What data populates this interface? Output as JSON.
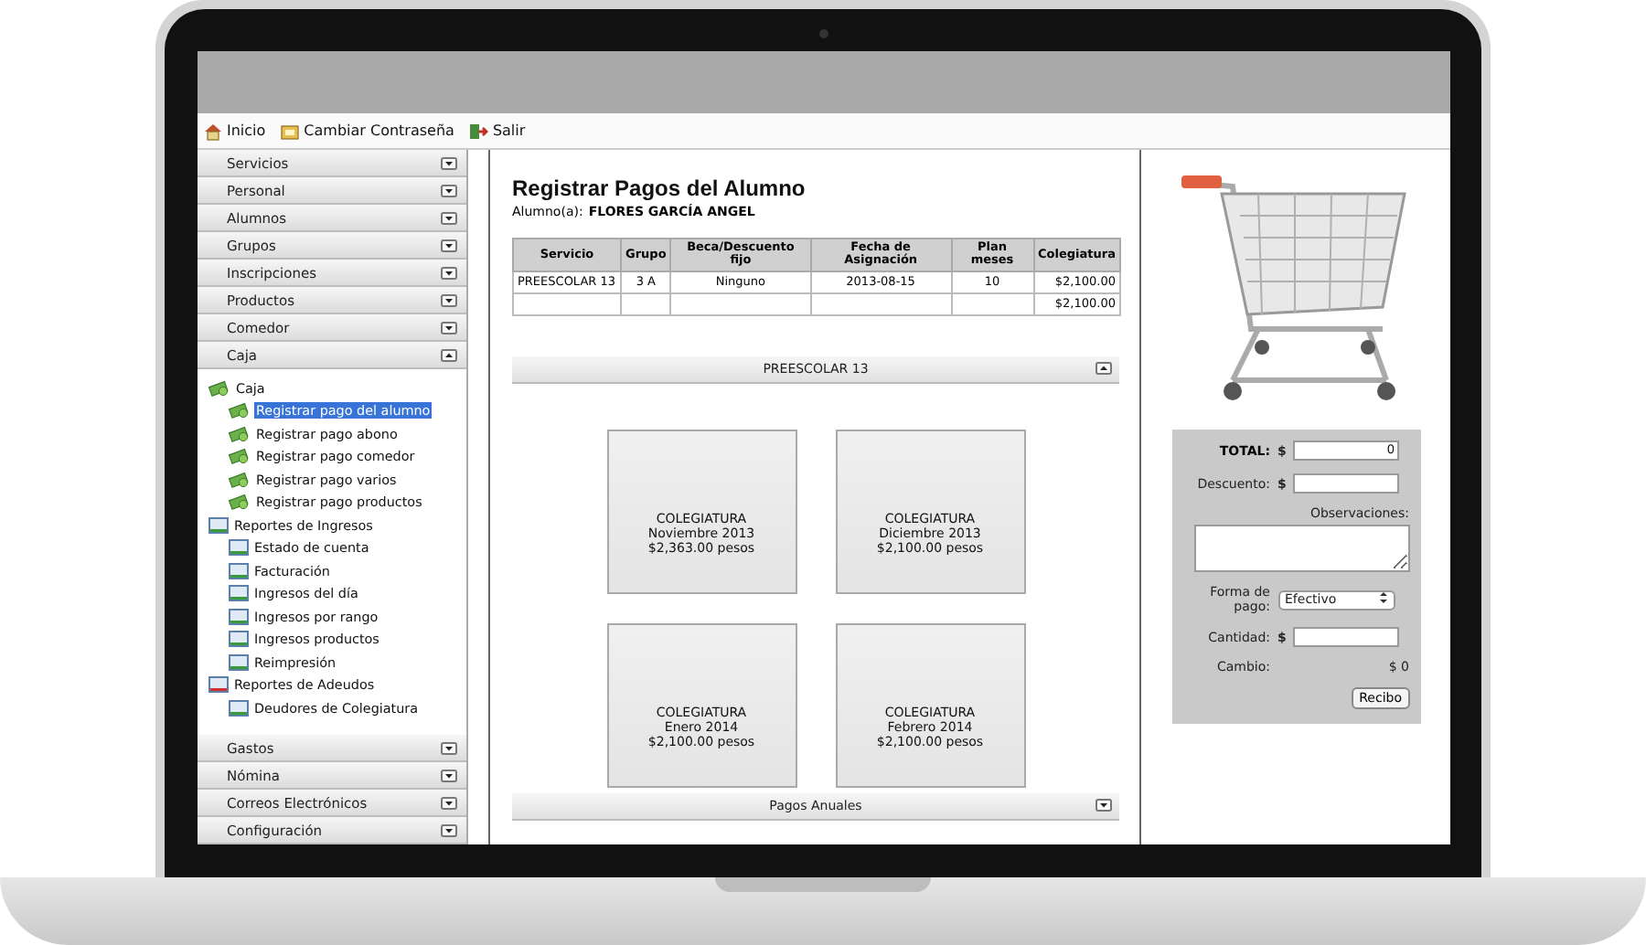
{
  "toolbar": [
    {
      "label": "Inicio"
    },
    {
      "label": "Cambiar Contraseña"
    },
    {
      "label": "Salir"
    }
  ],
  "sidebar": {
    "sections": [
      {
        "label": "Servicios",
        "expanded": false
      },
      {
        "label": "Personal",
        "expanded": false
      },
      {
        "label": "Alumnos",
        "expanded": false
      },
      {
        "label": "Grupos",
        "expanded": false
      },
      {
        "label": "Inscripciones",
        "expanded": false
      },
      {
        "label": "Productos",
        "expanded": false
      },
      {
        "label": "Comedor",
        "expanded": false
      },
      {
        "label": "Caja",
        "expanded": true,
        "children": [
          {
            "label": "Caja",
            "kind": "money",
            "selected": false,
            "children": [
              {
                "label": "Registrar pago del alumno",
                "kind": "money",
                "selected": true
              },
              {
                "label": "Registrar pago abono",
                "kind": "money",
                "selected": false
              },
              {
                "label": "Registrar pago comedor",
                "kind": "money",
                "selected": false
              },
              {
                "label": "Registrar pago varios",
                "kind": "money",
                "selected": false
              },
              {
                "label": "Registrar pago productos",
                "kind": "money",
                "selected": false
              }
            ]
          },
          {
            "label": "Reportes de Ingresos",
            "kind": "report-income",
            "selected": false,
            "children": [
              {
                "label": "Estado de cuenta",
                "kind": "report-income",
                "selected": false
              },
              {
                "label": "Facturación",
                "kind": "report-income",
                "selected": false
              },
              {
                "label": "Ingresos del día",
                "kind": "report-income",
                "selected": false
              },
              {
                "label": "Ingresos por rango",
                "kind": "report-income",
                "selected": false
              },
              {
                "label": "Ingresos productos",
                "kind": "report-income",
                "selected": false
              },
              {
                "label": "Reimpresión",
                "kind": "report-income",
                "selected": false
              }
            ]
          },
          {
            "label": "Reportes de Adeudos",
            "kind": "report-debt",
            "selected": false,
            "children": [
              {
                "label": "Deudores de Colegiatura",
                "kind": "report-income",
                "selected": false
              }
            ]
          }
        ]
      },
      {
        "label": "Gastos",
        "expanded": false
      },
      {
        "label": "Nómina",
        "expanded": false
      },
      {
        "label": "Correos Electrónicos",
        "expanded": false
      },
      {
        "label": "Configuración",
        "expanded": false
      }
    ]
  },
  "main": {
    "title": "Registrar Pagos del Alumno",
    "student_label": "Alumno(a):",
    "student_name": "FLORES GARCÍA ANGEL",
    "table": {
      "columns": [
        "Servicio",
        "Grupo",
        "Beca/Descuento fijo",
        "Fecha de Asignación",
        "Plan meses",
        "Colegiatura"
      ],
      "rows": [
        [
          "PREESCOLAR 13",
          "3 A",
          "Ninguno",
          "2013-08-15",
          "10",
          "$2,100.00"
        ]
      ],
      "total": "$2,100.00"
    },
    "panels": [
      {
        "title": "PREESCOLAR 13",
        "expanded": true,
        "payments": [
          {
            "concept": "COLEGIATURA",
            "month": "Noviembre 2013",
            "amount": "$2,363.00 pesos"
          },
          {
            "concept": "COLEGIATURA",
            "month": "Diciembre 2013",
            "amount": "$2,100.00 pesos"
          },
          {
            "concept": "COLEGIATURA",
            "month": "Enero 2014",
            "amount": "$2,100.00 pesos"
          },
          {
            "concept": "COLEGIATURA",
            "month": "Febrero 2014",
            "amount": "$2,100.00 pesos"
          }
        ]
      },
      {
        "title": "Pagos Anuales",
        "expanded": false
      }
    ]
  },
  "payment_form": {
    "fields": [
      {
        "kind": "total",
        "label": "TOTAL:",
        "prefix": "$",
        "value": "0"
      },
      {
        "kind": "input",
        "label": "Descuento:",
        "prefix": "$"
      },
      {
        "kind": "textarea",
        "label": "Observaciones:"
      },
      {
        "kind": "select",
        "label": "Forma de pago:",
        "value": "Efectivo"
      },
      {
        "kind": "input",
        "label": "Cantidad:",
        "prefix": "$"
      },
      {
        "kind": "readout",
        "label": "Cambio:",
        "value": "$ 0"
      }
    ],
    "button": "Recibo"
  }
}
